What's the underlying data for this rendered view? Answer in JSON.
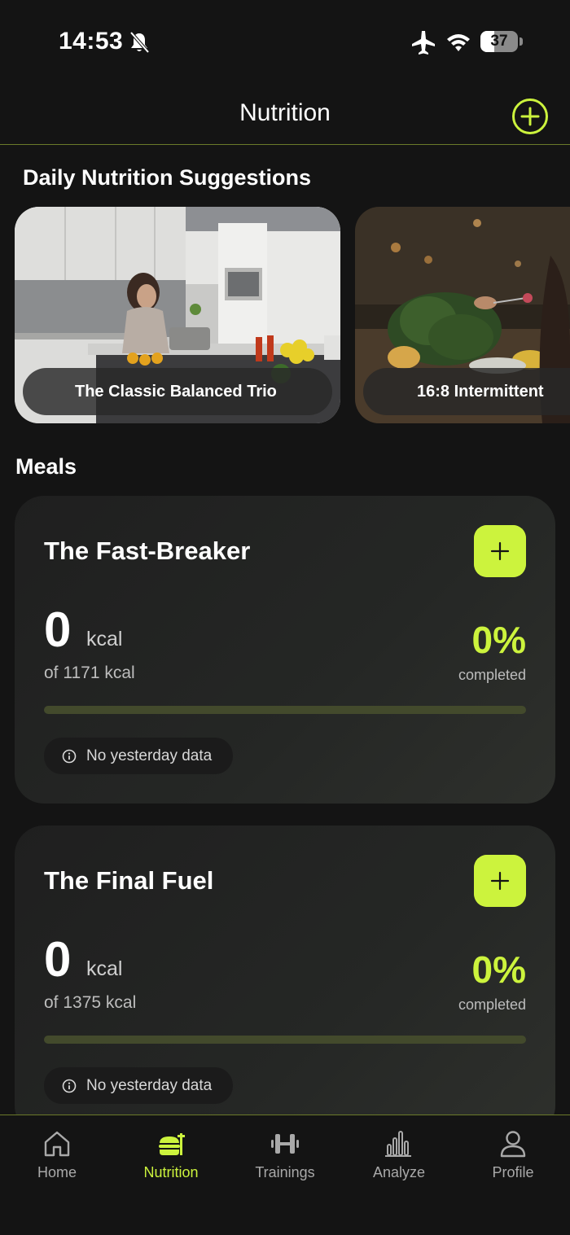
{
  "status_bar": {
    "time": "14:53",
    "battery": 37
  },
  "header": {
    "title": "Nutrition"
  },
  "suggestions": {
    "title": "Daily Nutrition Suggestions",
    "items": [
      {
        "label": "The Classic Balanced Trio"
      },
      {
        "label": "16:8 Intermittent"
      }
    ]
  },
  "meals": {
    "title": "Meals",
    "items": [
      {
        "name": "The Fast-Breaker",
        "kcal": "0",
        "unit": "kcal",
        "target": "of 1171 kcal",
        "percent_text": "0%",
        "percent": 0,
        "completed_label": "completed",
        "info": "No yesterday data"
      },
      {
        "name": "The Final Fuel",
        "kcal": "0",
        "unit": "kcal",
        "target": "of 1375 kcal",
        "percent_text": "0%",
        "percent": 0,
        "completed_label": "completed",
        "info": "No yesterday data"
      }
    ]
  },
  "tabs": [
    {
      "label": "Home",
      "icon": "home-icon",
      "active": false
    },
    {
      "label": "Nutrition",
      "icon": "burger-icon",
      "active": true
    },
    {
      "label": "Trainings",
      "icon": "dumbbell-icon",
      "active": false
    },
    {
      "label": "Analyze",
      "icon": "bar-chart-icon",
      "active": false
    },
    {
      "label": "Profile",
      "icon": "person-icon",
      "active": false
    }
  ],
  "colors": {
    "accent": "#ccf33d",
    "background": "#141414",
    "card": "#222422"
  }
}
